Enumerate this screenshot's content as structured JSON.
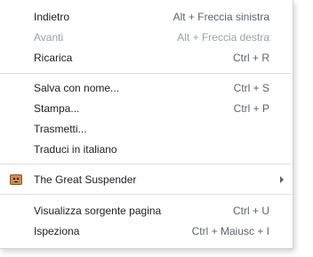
{
  "menu": {
    "items": [
      {
        "label": "Indietro",
        "shortcut": "Alt + Freccia sinistra"
      },
      {
        "label": "Avanti",
        "shortcut": "Alt + Freccia destra",
        "disabled": true
      },
      {
        "label": "Ricarica",
        "shortcut": "Ctrl + R"
      },
      {
        "label": "Salva con nome...",
        "shortcut": "Ctrl + S"
      },
      {
        "label": "Stampa...",
        "shortcut": "Ctrl + P"
      },
      {
        "label": "Trasmetti..."
      },
      {
        "label": "Traduci in italiano"
      },
      {
        "label": "The Great Suspender",
        "icon": "great-suspender-extension-icon",
        "submenu": true
      },
      {
        "label": "Visualizza sorgente pagina",
        "shortcut": "Ctrl + U"
      },
      {
        "label": "Ispeziona",
        "shortcut": "Ctrl + Maiusc + I"
      }
    ]
  }
}
